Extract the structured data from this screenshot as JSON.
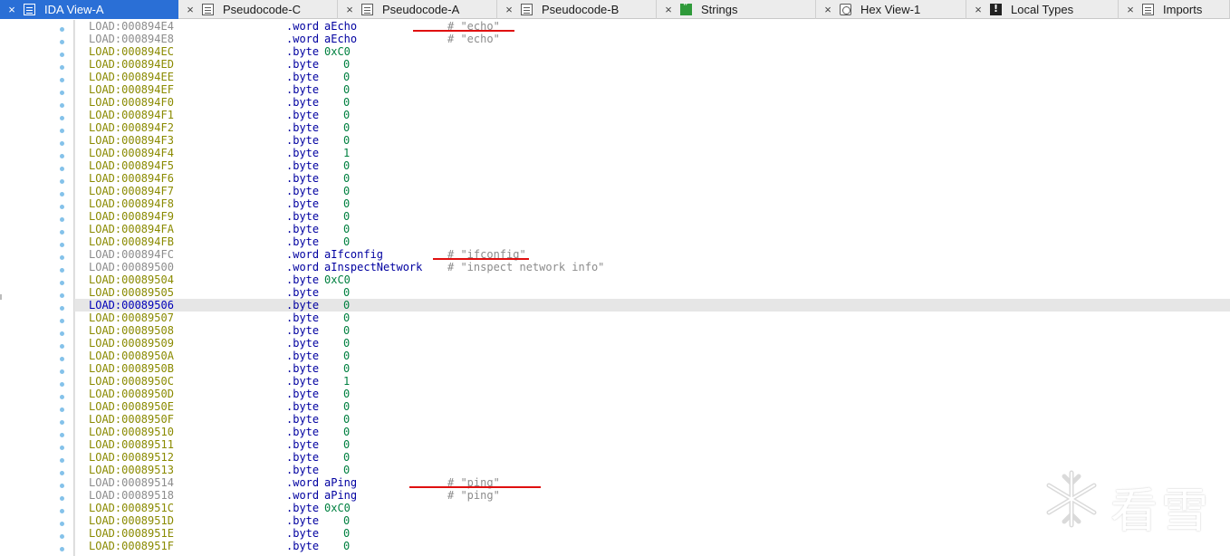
{
  "tabs": [
    {
      "label": "IDA View-A",
      "icon": "listing-icon",
      "active": true
    },
    {
      "label": "Pseudocode-C",
      "icon": "listing-icon",
      "active": false
    },
    {
      "label": "Pseudocode-A",
      "icon": "listing-icon",
      "active": false
    },
    {
      "label": "Pseudocode-B",
      "icon": "listing-icon",
      "active": false
    },
    {
      "label": "Strings",
      "icon": "strings-icon",
      "active": false
    },
    {
      "label": "Hex View-1",
      "icon": "hex-icon",
      "active": false
    },
    {
      "label": "Local Types",
      "icon": "local-types-icon",
      "active": false
    },
    {
      "label": "Imports",
      "icon": "imports-icon",
      "active": false
    }
  ],
  "close_glyph": "×",
  "listing": [
    {
      "addr": "LOAD:000894E4",
      "mnem": ".word",
      "arg": "aEcho",
      "comment": "# \"echo\""
    },
    {
      "addr": "LOAD:000894E8",
      "mnem": ".word",
      "arg": "aEcho",
      "comment": "# \"echo\""
    },
    {
      "addr": "LOAD:000894EC",
      "mnem": ".byte",
      "num": "0xC0"
    },
    {
      "addr": "LOAD:000894ED",
      "mnem": ".byte",
      "num": "0"
    },
    {
      "addr": "LOAD:000894EE",
      "mnem": ".byte",
      "num": "0"
    },
    {
      "addr": "LOAD:000894EF",
      "mnem": ".byte",
      "num": "0"
    },
    {
      "addr": "LOAD:000894F0",
      "mnem": ".byte",
      "num": "0"
    },
    {
      "addr": "LOAD:000894F1",
      "mnem": ".byte",
      "num": "0"
    },
    {
      "addr": "LOAD:000894F2",
      "mnem": ".byte",
      "num": "0"
    },
    {
      "addr": "LOAD:000894F3",
      "mnem": ".byte",
      "num": "0"
    },
    {
      "addr": "LOAD:000894F4",
      "mnem": ".byte",
      "num": "1"
    },
    {
      "addr": "LOAD:000894F5",
      "mnem": ".byte",
      "num": "0"
    },
    {
      "addr": "LOAD:000894F6",
      "mnem": ".byte",
      "num": "0"
    },
    {
      "addr": "LOAD:000894F7",
      "mnem": ".byte",
      "num": "0"
    },
    {
      "addr": "LOAD:000894F8",
      "mnem": ".byte",
      "num": "0"
    },
    {
      "addr": "LOAD:000894F9",
      "mnem": ".byte",
      "num": "0"
    },
    {
      "addr": "LOAD:000894FA",
      "mnem": ".byte",
      "num": "0"
    },
    {
      "addr": "LOAD:000894FB",
      "mnem": ".byte",
      "num": "0"
    },
    {
      "addr": "LOAD:000894FC",
      "mnem": ".word",
      "arg": "aIfconfig",
      "comment": "# \"ifconfig\""
    },
    {
      "addr": "LOAD:00089500",
      "mnem": ".word",
      "arg": "aInspectNetwork",
      "comment": "# \"inspect network info\""
    },
    {
      "addr": "LOAD:00089504",
      "mnem": ".byte",
      "num": "0xC0"
    },
    {
      "addr": "LOAD:00089505",
      "mnem": ".byte",
      "num": "0"
    },
    {
      "addr": "LOAD:00089506",
      "mnem": ".byte",
      "num": "0",
      "selected": true
    },
    {
      "addr": "LOAD:00089507",
      "mnem": ".byte",
      "num": "0"
    },
    {
      "addr": "LOAD:00089508",
      "mnem": ".byte",
      "num": "0"
    },
    {
      "addr": "LOAD:00089509",
      "mnem": ".byte",
      "num": "0"
    },
    {
      "addr": "LOAD:0008950A",
      "mnem": ".byte",
      "num": "0"
    },
    {
      "addr": "LOAD:0008950B",
      "mnem": ".byte",
      "num": "0"
    },
    {
      "addr": "LOAD:0008950C",
      "mnem": ".byte",
      "num": "1"
    },
    {
      "addr": "LOAD:0008950D",
      "mnem": ".byte",
      "num": "0"
    },
    {
      "addr": "LOAD:0008950E",
      "mnem": ".byte",
      "num": "0"
    },
    {
      "addr": "LOAD:0008950F",
      "mnem": ".byte",
      "num": "0"
    },
    {
      "addr": "LOAD:00089510",
      "mnem": ".byte",
      "num": "0"
    },
    {
      "addr": "LOAD:00089511",
      "mnem": ".byte",
      "num": "0"
    },
    {
      "addr": "LOAD:00089512",
      "mnem": ".byte",
      "num": "0"
    },
    {
      "addr": "LOAD:00089513",
      "mnem": ".byte",
      "num": "0"
    },
    {
      "addr": "LOAD:00089514",
      "mnem": ".word",
      "arg": "aPing",
      "comment": "# \"ping\""
    },
    {
      "addr": "LOAD:00089518",
      "mnem": ".word",
      "arg": "aPing",
      "comment": "# \"ping\""
    },
    {
      "addr": "LOAD:0008951C",
      "mnem": ".byte",
      "num": "0xC0"
    },
    {
      "addr": "LOAD:0008951D",
      "mnem": ".byte",
      "num": "0"
    },
    {
      "addr": "LOAD:0008951E",
      "mnem": ".byte",
      "num": "0"
    },
    {
      "addr": "LOAD:0008951F",
      "mnem": ".byte",
      "num": "0"
    }
  ],
  "watermark": {
    "text": "看雪"
  },
  "colors": {
    "tab_active": "#2a6fd6",
    "address": "#8a8a00",
    "mnemonic": "#0000a0",
    "number": "#008040",
    "comment": "#8c8c8c",
    "annotation": "#e01010"
  }
}
